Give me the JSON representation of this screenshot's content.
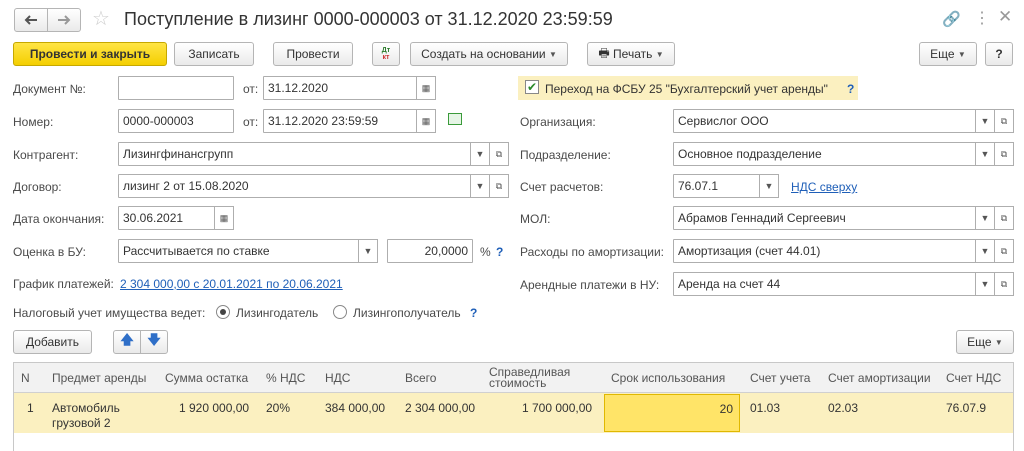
{
  "window": {
    "title": "Поступление в лизинг 0000-000003 от 31.12.2020 23:59:59",
    "link_icon": "link-icon",
    "more_icon": "more-icon",
    "close_icon": "close-icon"
  },
  "toolbar": {
    "post_and_close": "Провести и закрыть",
    "save": "Записать",
    "post": "Провести",
    "create_based_on": "Создать на основании",
    "print": "Печать",
    "more": "Еще",
    "help": "?"
  },
  "form": {
    "doc_number_label": "Документ №:",
    "doc_number_value": "",
    "from_label": "от:",
    "doc_date_value": "31.12.2020",
    "fsbu_checkbox_label": "Переход на ФСБУ 25 \"Бухгалтерский учет аренды\"",
    "fsbu_help": "?",
    "number_label": "Номер:",
    "number_value": "0000-000003",
    "number_date_value": "31.12.2020 23:59:59",
    "organization_label": "Организация:",
    "organization_value": "Сервислог ООО",
    "counterparty_label": "Контрагент:",
    "counterparty_value": "Лизингфинансгрупп",
    "subdivision_label": "Подразделение:",
    "subdivision_value": "Основное подразделение",
    "contract_label": "Договор:",
    "contract_value": "лизинг 2 от 15.08.2020",
    "settlement_account_label": "Счет расчетов:",
    "settlement_account_value": "76.07.1",
    "vat_link": "НДС сверху",
    "end_date_label": "Дата окончания:",
    "end_date_value": "30.06.2021",
    "mol_label": "МОЛ:",
    "mol_value": "Абрамов Геннадий Сергеевич",
    "valuation_label": "Оценка в БУ:",
    "valuation_value": "Рассчитывается по ставке",
    "rate_value": "20,0000",
    "rate_unit": "%",
    "rate_help": "?",
    "amortization_label": "Расходы по амортизации:",
    "amortization_value": "Амортизация (счет 44.01)",
    "schedule_label": "График платежей:",
    "schedule_link": "2 304 000,00 с 20.01.2021 по 20.06.2021",
    "lease_payments_label": "Арендные платежи в НУ:",
    "lease_payments_value": "Аренда на счет 44",
    "tax_label": "Налоговый учет имущества ведет:",
    "radio_lessor": "Лизингодатель",
    "radio_lessee": "Лизингополучатель",
    "radio_selected": "Лизингодатель",
    "tax_help": "?"
  },
  "table_toolbar": {
    "add": "Добавить",
    "up_icon": "arrow-up-icon",
    "down_icon": "arrow-down-icon",
    "more": "Еще"
  },
  "table": {
    "columns": [
      "N",
      "Предмет аренды",
      "Сумма остатка",
      "% НДС",
      "НДС",
      "Всего",
      "Справедливая стоимость",
      "Срок использования",
      "Счет учета",
      "Счет амортизации",
      "Счет НДС"
    ],
    "rows": [
      {
        "n": "1",
        "item": "Автомобиль грузовой 2",
        "balance": "1 920 000,00",
        "vat_rate": "20%",
        "vat": "384 000,00",
        "total": "2 304 000,00",
        "fair_value": "1 700 000,00",
        "term": "20",
        "account": "01.03",
        "amort_account": "02.03",
        "vat_account": "76.07.9"
      }
    ]
  }
}
